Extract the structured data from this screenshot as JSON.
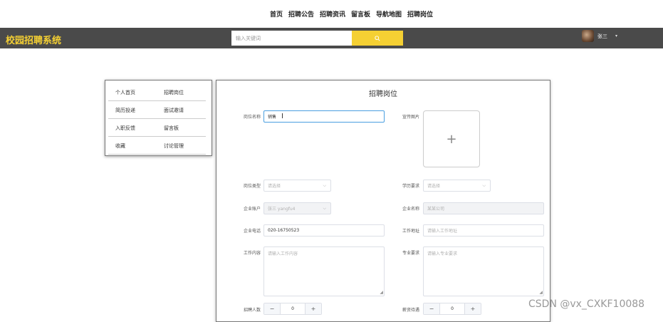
{
  "topnav": {
    "items": [
      "首页",
      "招聘公告",
      "招聘资讯",
      "留言板",
      "导航地图",
      "招聘岗位"
    ]
  },
  "header": {
    "brand": "校园招聘系统",
    "search_placeholder": "输入关键词",
    "user_name": "张三",
    "caret": "▾"
  },
  "sidebar": {
    "rows": [
      [
        "个人首页",
        "招聘岗位"
      ],
      [
        "简历投递",
        "面试邀请"
      ],
      [
        "入职反馈",
        "留言板"
      ],
      [
        "收藏",
        "讨论管理"
      ]
    ]
  },
  "form": {
    "title": "招聘岗位",
    "job_name": {
      "label": "岗位名称",
      "value": "销售"
    },
    "promo_image": {
      "label": "宣传图片",
      "plus": "+"
    },
    "job_category": {
      "label": "岗位类型",
      "placeholder": "请选择"
    },
    "education": {
      "label": "学历要求",
      "placeholder": "请选择"
    },
    "company_account": {
      "label": "企业账户",
      "value": "张三 yangfu4"
    },
    "company_name": {
      "label": "企业名称",
      "placeholder": "某某公司"
    },
    "company_phone": {
      "label": "企业电话",
      "value": "020-16750523"
    },
    "work_address": {
      "label": "工作地址",
      "placeholder": "请输入工作地址"
    },
    "job_content": {
      "label": "工作内容",
      "placeholder": "请输入工作内容"
    },
    "major_req": {
      "label": "专业要求",
      "placeholder": "请输入专业要求"
    },
    "hire_count": {
      "label": "招聘人数",
      "value": "0",
      "minus": "−",
      "plus": "+"
    },
    "salary": {
      "label": "薪资待遇",
      "value": "0",
      "minus": "−",
      "plus": "+"
    }
  },
  "watermark": "CSDN @vx_CXKF10088",
  "colors": {
    "brand": "#f5d033",
    "bar": "#4a4a4a",
    "focus": "#4a9fe0"
  }
}
